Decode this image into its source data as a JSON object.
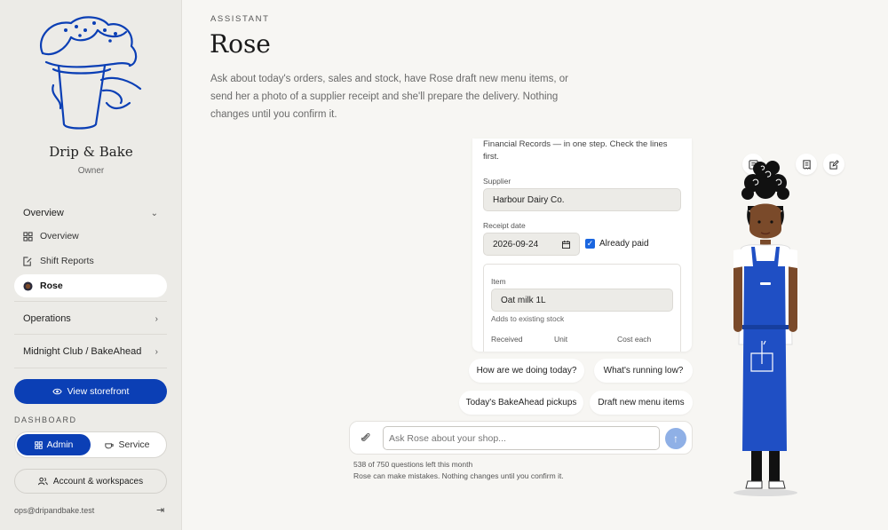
{
  "sidebar": {
    "brand": "Drip & Bake",
    "role": "Owner",
    "overview_group": "Overview",
    "items": [
      {
        "label": "Overview",
        "icon": "grid-icon"
      },
      {
        "label": "Shift Reports",
        "icon": "report-edit-icon"
      },
      {
        "label": "Rose",
        "icon": "avatar-icon",
        "active": true
      }
    ],
    "operations": "Operations",
    "midnight": "Midnight Club / BakeAhead",
    "view_storefront": "View storefront",
    "dashboard_label": "DASHBOARD",
    "toggle_admin": "Admin",
    "toggle_service": "Service",
    "account": "Account & workspaces",
    "email": "ops@dripandbake.test"
  },
  "main": {
    "eyebrow": "ASSISTANT",
    "title": "Rose",
    "intro": "Ask about today's orders, sales and stock, have Rose draft new menu items, or send her a photo of a supplier receipt and she'll prepare the delivery. Nothing changes until you confirm it."
  },
  "card": {
    "intro": "Financial Records — in one step. Check the lines first.",
    "supplier_label": "Supplier",
    "supplier_value": "Harbour Dairy Co.",
    "date_label": "Receipt date",
    "date_value": "2026-09-24",
    "paid_label": "Already paid",
    "item_label": "Item",
    "item_value": "Oat milk 1L",
    "item_hint": "Adds to existing stock",
    "col_received": "Received",
    "col_unit": "Unit",
    "col_cost": "Cost each"
  },
  "suggestions": [
    "How are we doing today?",
    "What's running low?",
    "Today's BakeAhead pickups",
    "Draft new menu items"
  ],
  "composer": {
    "placeholder": "Ask Rose about your shop...",
    "quota": "538 of 750 questions left this month",
    "disclaimer": "Rose can make mistakes. Nothing changes until you confirm it."
  },
  "colors": {
    "accent": "#0b3fb5",
    "apron": "#1f4fc4",
    "sidebar_bg": "#ecebe7"
  }
}
